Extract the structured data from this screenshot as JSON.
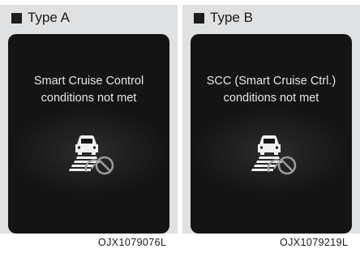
{
  "panels": [
    {
      "label": "Type A",
      "message_line1": "Smart Cruise Control",
      "message_line2": "conditions not met",
      "icon": "cruise-unavailable-icon",
      "code": "OJX1079076L"
    },
    {
      "label": "Type B",
      "message_line1": "SCC (Smart Cruise Ctrl.)",
      "message_line2": "conditions not met",
      "icon": "cruise-unavailable-icon",
      "code": "OJX1079219L"
    }
  ],
  "colors": {
    "panel_bg": "#e0e1e2",
    "screen_bg": "#141414",
    "text_light": "#e6e6e6",
    "icon_white": "#f0f0f0",
    "icon_gray": "#9a9a9a"
  }
}
